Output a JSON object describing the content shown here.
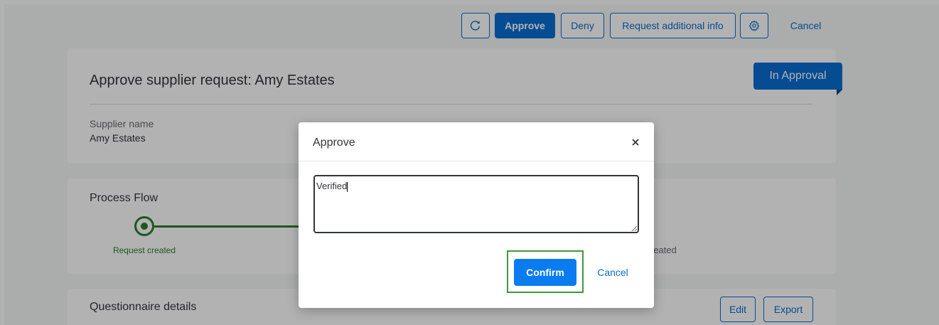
{
  "toolbar": {
    "refresh_icon": "refresh-icon",
    "approve_label": "Approve",
    "deny_label": "Deny",
    "request_info_label": "Request additional info",
    "settings_icon": "gear-icon",
    "cancel_label": "Cancel"
  },
  "header": {
    "title": "Approve supplier request: Amy Estates",
    "status": "In Approval",
    "fields": [
      {
        "label": "Supplier name",
        "value": "Amy Estates"
      }
    ]
  },
  "process_flow": {
    "title": "Process Flow",
    "steps": [
      {
        "label": "Request created"
      }
    ],
    "partial_right_label": "reated"
  },
  "questionnaire": {
    "title": "Questionnaire details",
    "edit_label": "Edit",
    "export_label": "Export"
  },
  "dialog": {
    "title": "Approve",
    "close_icon": "close-icon",
    "comment_value": "Verified",
    "confirm_label": "Confirm",
    "cancel_label": "Cancel"
  },
  "colors": {
    "accent": "#0a6ed1",
    "success": "#2b7d2b",
    "status_badge": "#0a6ed1",
    "highlight_box": "#3a9a3a"
  }
}
